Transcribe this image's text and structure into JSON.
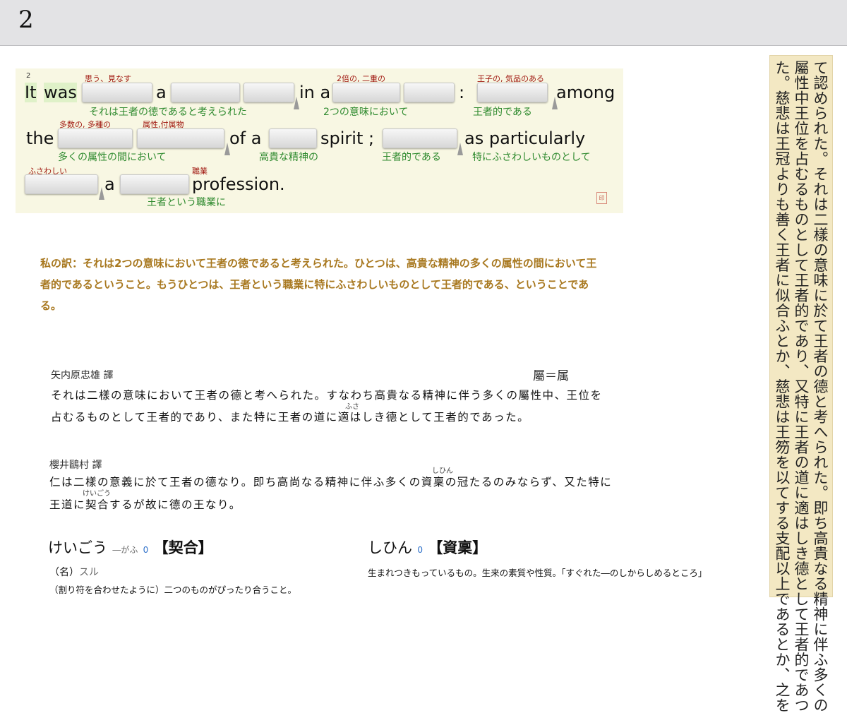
{
  "page_number": "2",
  "exercise": {
    "index": "2",
    "line1": {
      "w_it": "It",
      "w_was": "was",
      "w_a": "a",
      "w_in_a": "in a",
      "w_colon": ":",
      "w_among": "among",
      "hint_regarded": "思う、見なす",
      "hint_double": "2倍の, 二重の",
      "hint_royal": "王子の, 気品のある",
      "trans1": "それは王者の徳であると考えられた",
      "trans2": "2つの意味において",
      "trans3": "王者的である"
    },
    "line2": {
      "w_the": "the",
      "w_of_a": "of a",
      "w_spirit": "spirit ;",
      "w_as": "as particularly",
      "hint_many": "多数の, 多種の",
      "hint_attr": "属性,付属物",
      "trans1": "多くの属性の間において",
      "trans2": "高貴な精神の",
      "trans3": "王者的である",
      "trans4": "特にふさわしいものとして"
    },
    "line3": {
      "w_a": "a",
      "w_profession": "profession.",
      "hint_fit": "ふさわしい",
      "hint_job": "職業",
      "trans1": "王者という職業に",
      "seal": "印"
    }
  },
  "my_translation": "私の訳：それは2つの意味において王者の徳であると考えられた。ひとつは、高貴な精神の多くの属性の間において王者的であるということ。もうひとつは、王者という職業に特にふさわしいものとして王者的である、ということである。",
  "yanaihara": {
    "name": "矢内原忠雄 譯",
    "note": "屬＝属",
    "line1": "それは二樣の意味において王者の德と考へられた。すなわち高貴なる精神に伴う多くの屬性中、王位を",
    "line2": "占むるものとして王者的であり、また特に王者の道に適はしき德として王者的であった。",
    "ruby_fusa": "ふさ"
  },
  "sakurai": {
    "name": "櫻井鷗村 譯",
    "line1": "仁は二樣の意義に於て王者の德なり。即ち高尚なる精神に伴ふ多くの資稟の冠たるのみならず、又た特に",
    "line2": "王道に契合するが故に德の王なり。",
    "ruby_shihin": "しひん",
    "ruby_keigou": "けいごう"
  },
  "dict": {
    "keigou": {
      "reading": "けいごう",
      "sub": "―がふ",
      "num": "0",
      "kanji": "【契合】",
      "pos": "（名）",
      "suru": "スル",
      "definition": "（割り符を合わせたように）二つのものがぴったり合うこと。"
    },
    "shihin": {
      "reading": "しひん",
      "num": "0",
      "kanji": "【資稟】",
      "definition": "生まれつきもっているもの。生来の素質や性質。「すぐれた―のしからしめるところ」"
    }
  },
  "vertical_text": {
    "col1": "て認められた。それは二樣の意味に於て王者の德と考へられた。即ち高貴なる精神に伴ふ多くの",
    "col2": "屬性中王位を占むるものとして王者的であり、又特に王者の道に適はしき德として王者的であつ",
    "col3": "た。慈悲は王冠よりも善く王者に似合ふとか、慈悲は王笏を以てする支配以上であるとか、之を"
  }
}
